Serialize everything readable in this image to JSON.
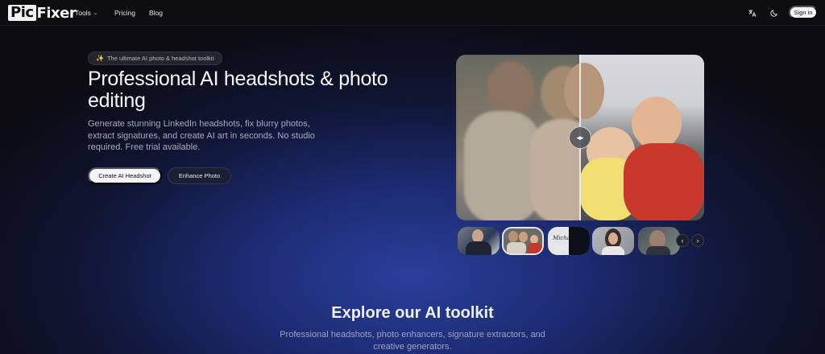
{
  "brand": {
    "logo_pic": "Pic",
    "logo_fixer": "Fixer"
  },
  "nav": {
    "tools_label": "Tools",
    "pricing_label": "Pricing",
    "blog_label": "Blog"
  },
  "header_actions": {
    "translate_icon": "translate-icon",
    "theme_icon": "moon-icon",
    "signin_label": "Sign in"
  },
  "hero": {
    "badge_icon": "sparkle-icon",
    "badge_text": "The ultimate AI photo & headshot toolkit",
    "title": "Professional AI headshots & photo editing",
    "description": "Generate stunning LinkedIn headshots, fix blurry photos, extract signatures, and create AI art in seconds. No studio required. Free trial available.",
    "primary_button": "Create AI Headshot",
    "secondary_button": "Enhance Photo"
  },
  "comparison": {
    "handle_icon": "compare-arrows-icon",
    "slider_position": 0.5
  },
  "carousel": {
    "thumbnails": [
      "portrait-man-suit",
      "family-photo",
      "signature",
      "portrait-woman",
      "portrait-man-glasses"
    ],
    "active_index": 1,
    "signature_text": "Michael",
    "prev_icon": "chevron-left-icon",
    "next_icon": "chevron-right-icon"
  },
  "toolkit": {
    "title": "Explore our AI toolkit",
    "description": "Professional headshots, photo enhancers, signature extractors, and creative generators."
  },
  "colors": {
    "background": "#0b0b0f",
    "glow": "#2a3f9c",
    "primary_button_bg": "#f4f4f6"
  }
}
